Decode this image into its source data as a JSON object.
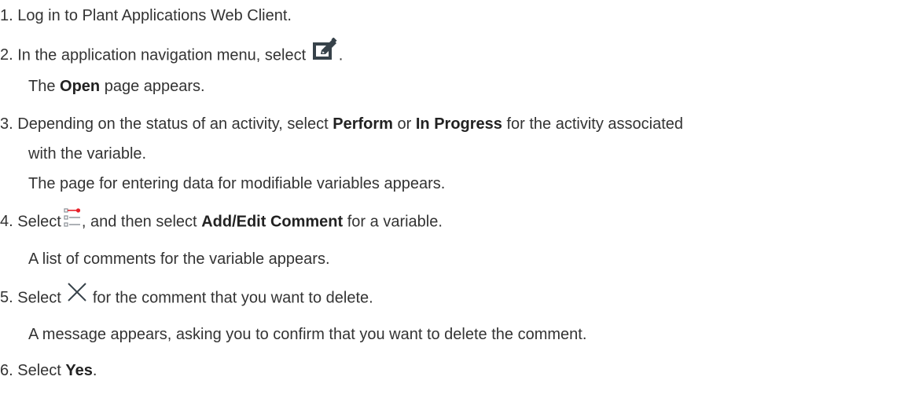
{
  "steps": [
    {
      "number": "1.",
      "text": "Log in to Plant Applications Web Client."
    },
    {
      "number": "2.",
      "text_before_icon": "In the application navigation menu, select",
      "text_after_icon": ".",
      "result_bold": "Open",
      "result_rest": "page appears."
    },
    {
      "number": "3.",
      "text_a": "Depending on the status of an activity, select",
      "bold_a": "Perform",
      "text_b": "or",
      "bold_b": "In Progress",
      "text_c": "for the activity associated",
      "text_wrap": "with the variable.",
      "result": "The page for entering data for modifiable variables appears."
    },
    {
      "number": "4.",
      "text_before_icon": "Select",
      "text_after_icon": ", and then select",
      "bold": "Add/Edit Comment",
      "text_end": "for a variable.",
      "result": "A list of comments for the variable appears."
    },
    {
      "number": "5.",
      "text_before_icon": "Select",
      "text_after_icon": "for the comment that you want to delete.",
      "result": "A message appears, asking you to confirm that you want to delete the comment."
    },
    {
      "number": "6.",
      "text_before_bold": "Select",
      "bold": "Yes",
      "text_end": "."
    }
  ],
  "result_prefix": "The",
  "icons": {
    "step2": "edit-square-icon",
    "step4": "comment-list-icon",
    "step5": "close-x-icon"
  },
  "colors": {
    "text": "#333333",
    "icon_dark": "#37424a",
    "icon_accent": "#e8202a",
    "icon_grey": "#8a9096"
  }
}
